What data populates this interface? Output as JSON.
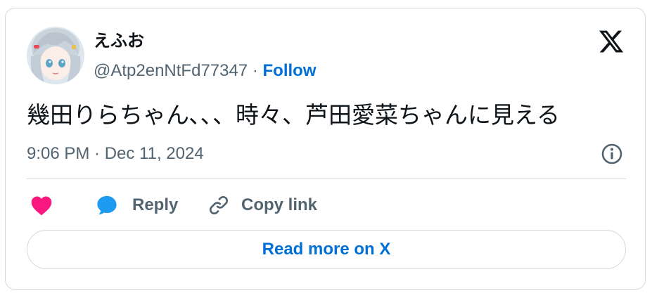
{
  "author": {
    "display_name": "えふお",
    "handle": "@Atp2enNtFd77347",
    "separator": " · ",
    "follow_label": "Follow"
  },
  "tweet": {
    "text": "幾田りらちゃん､､、時々、芦田愛菜ちゃんに見える",
    "timestamp": "9:06 PM · Dec 11, 2024"
  },
  "actions": {
    "reply_label": "Reply",
    "copy_link_label": "Copy link"
  },
  "read_more_label": "Read more on X",
  "icons": {
    "logo": "x-logo-icon",
    "info": "info-icon",
    "like": "heart-icon",
    "reply": "speech-bubble-icon",
    "copy": "link-icon"
  },
  "colors": {
    "text_primary": "#0f1419",
    "text_secondary": "#536471",
    "link_blue": "#006fd6",
    "like_pink": "#f91880",
    "reply_blue": "#1d9bf0",
    "border": "#cfd9de"
  }
}
